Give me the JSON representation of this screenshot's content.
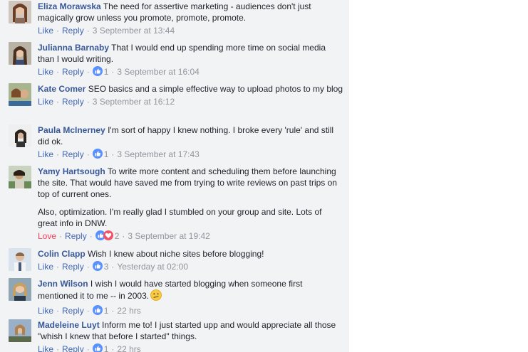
{
  "comments": [
    {
      "name": "Eliza Morawska",
      "text": "The need for assertive marketing - audiences don't just magically grow unless you promote, promote, promote.",
      "action1": "Like",
      "reply": "Reply",
      "reaction_count": "",
      "timestamp": "3 September at 13:44"
    },
    {
      "name": "Julianna Barnaby",
      "text": "That I would end up spending more time on social media than I would writing.",
      "action1": "Like",
      "reply": "Reply",
      "reaction_count": "1",
      "timestamp": "3 September at 16:04"
    },
    {
      "name": "Kate Comer",
      "text": "SEO basics and a simple effective way to upload photos to my blog",
      "action1": "Like",
      "reply": "Reply",
      "reaction_count": "",
      "timestamp": "3 September at 16:12"
    },
    {
      "name": "Paula McInerney",
      "text": "I'm sort of happy I knew nothing. I broke every 'rule' and still did ok.",
      "action1": "Like",
      "reply": "Reply",
      "reaction_count": "1",
      "timestamp": "3 September at 17:43"
    },
    {
      "name": "Yamy Hartsough",
      "text": "To write more content and scheduling them before launching the site. That would have saved me from trying to write reviews on past trips on top of current ones.",
      "text2": "Also, optimization. I'm really glad I stumbled on your group and site. Lots of great info in DNW.",
      "action1": "Love",
      "reply": "Reply",
      "reaction_count": "2",
      "timestamp": "3 September at 19:42"
    },
    {
      "name": "Colin Clapp",
      "text": "Wish I knew about niche sites before blogging!",
      "action1": "Like",
      "reply": "Reply",
      "reaction_count": "3",
      "timestamp": "Yesterday at 02:00"
    },
    {
      "name": "Jenn Wilson",
      "text": "I wish I would have started blogging when someone first mentioned it to me -- in 2003.",
      "action1": "Like",
      "reply": "Reply",
      "reaction_count": "1",
      "timestamp": "22 hrs"
    },
    {
      "name": "Madeleine Luyt",
      "text": "Inform me to! I just started upp and would appreciate all those \"whish I knew that before I started\" things.",
      "action1": "Like",
      "reply": "Reply",
      "reaction_count": "1",
      "timestamp": "22 hrs"
    }
  ],
  "icons": {
    "like_reaction": "like-reaction-icon",
    "love_reaction": "love-reaction-icon",
    "confused_emoji": "confused-emoji-icon"
  },
  "colors": {
    "name": "#385898",
    "action_link": "#4267b2",
    "love": "#f33e58",
    "meta": "#90949c",
    "panel_bg": "#f2f3f5"
  }
}
